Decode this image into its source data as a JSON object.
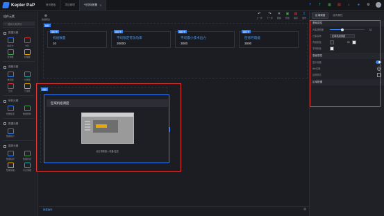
{
  "app": {
    "logo": "Kepler PaP",
    "tabs": [
      {
        "label": "首页看板"
      },
      {
        "label": "项目管理"
      },
      {
        "label": "*可视化配置",
        "active": true
      }
    ]
  },
  "top_icons": [
    {
      "name": "help-icon",
      "color": "#2f7df6",
      "glyph": "?"
    },
    {
      "name": "shirt-icon",
      "color": "#26a69a",
      "glyph": "T"
    },
    {
      "name": "grid-icon",
      "color": "#43a047",
      "glyph": "▦"
    },
    {
      "name": "doc-icon",
      "color": "#e53935",
      "glyph": "▤"
    },
    {
      "name": "download-icon",
      "color": "#fdd835",
      "glyph": "↓"
    },
    {
      "name": "bell-icon",
      "color": "#2f7df6",
      "glyph": "●"
    },
    {
      "name": "settings-icon",
      "color": "#c9ccd2",
      "glyph": "⚙"
    }
  ],
  "left_panel": {
    "title": "组件元素",
    "search_placeholder": "搜索元素类别",
    "sections": [
      {
        "title": "数据元素",
        "items": [
          {
            "label": "指标卡",
            "color": "#2f7df6"
          },
          {
            "label": "卡片",
            "color": "#e53935"
          },
          {
            "label": "查询框",
            "color": "#43a047"
          },
          {
            "label": "管理器",
            "color": "#e6a700"
          }
        ]
      },
      {
        "title": "视频元素",
        "items": [
          {
            "label": "单视频",
            "color": "#2f7df6"
          },
          {
            "label": "分屏器",
            "color": "#26a69a"
          },
          {
            "label": "云台",
            "color": "#e53935"
          },
          {
            "label": "下拉框",
            "color": "#e6a700"
          }
        ]
      },
      {
        "title": "研判元素",
        "items": [
          {
            "label": "智能检索",
            "color": "#2f7df6"
          },
          {
            "label": "数量研判",
            "color": "#43a047"
          }
        ]
      },
      {
        "title": "数据元素",
        "items": [
          {
            "label": "数据统计",
            "color": "#2f7df6"
          }
        ]
      },
      {
        "title": "图表元素",
        "items": [
          {
            "label": "数据柱状",
            "color": "#2f7df6"
          },
          {
            "label": "数据折线",
            "color": "#43a047"
          },
          {
            "label": "数据饼图",
            "color": "#e6a700"
          },
          {
            "label": "仪表饼图",
            "color": "#26a69a"
          }
        ]
      }
    ]
  },
  "canvas": {
    "toolbar_left": {
      "label": "数据概述"
    },
    "toolbar_right": [
      {
        "label": "上一步",
        "glyph": "↶",
        "color": "#c9ccd2"
      },
      {
        "label": "下一步",
        "glyph": "↷",
        "color": "#c9ccd2"
      },
      {
        "label": "删除",
        "glyph": "✕",
        "color": "#c9ccd2"
      },
      {
        "label": "预览",
        "glyph": "▣",
        "color": "#43a047"
      },
      {
        "label": "保存",
        "glyph": "▤",
        "color": "#e53935"
      },
      {
        "label": "发布",
        "glyph": "↥",
        "color": "#2f7df6"
      }
    ],
    "indicator_region_tag": "指标",
    "indicator_cards": [
      {
        "tag": "指标卡",
        "label": "机组数量",
        "value": "10"
      },
      {
        "tag": "指标卡",
        "label": "平均限定有功功率",
        "value": "20000"
      },
      {
        "tag": "指标卡",
        "label": "平均最小技术出力",
        "value": "3000"
      },
      {
        "tag": "指标卡",
        "label": "检修月电能",
        "value": "3000"
      }
    ],
    "video_region_tag": "视频",
    "video": {
      "title": "区域机组调度",
      "hint": "点击视频接入设备/监控"
    },
    "footer_tab": "新建画布"
  },
  "right_panel": {
    "tabs": [
      {
        "label": "区域调度",
        "active": true
      },
      {
        "label": "画布属性",
        "active": false
      }
    ],
    "sections": {
      "basic": "基础属性",
      "advanced": "高级属性",
      "other": "区域配置"
    },
    "fields": {
      "transparency_label": "元素透明度",
      "transparency_value": "11",
      "transparency_level": 0.35,
      "name_label": "元素名称",
      "name_value": "区域机组调度",
      "bg_color_label": "背景颜色",
      "font_size_value": "20",
      "border_color_label": "字体颜色",
      "show_title_label": "显示标题",
      "view_position_label": "title位置",
      "border_style_label": "边框样式"
    }
  }
}
